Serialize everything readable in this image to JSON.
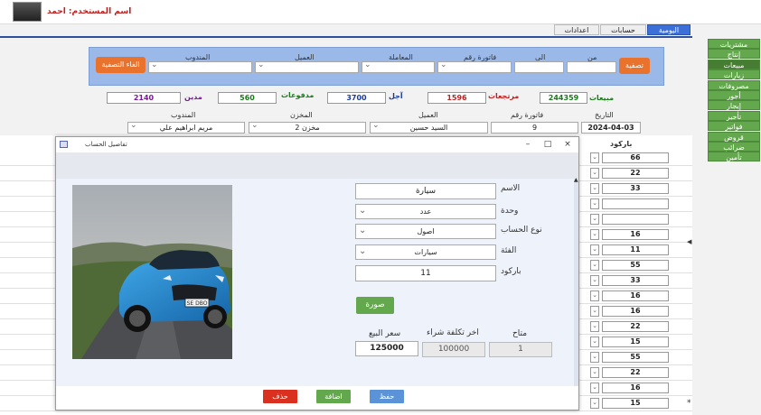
{
  "header": {
    "username_label": "اسم المستخدم: احمد"
  },
  "tabs": [
    "اليومية",
    "حسابات",
    "اعدادات"
  ],
  "filter": {
    "filter_btn": "تصفية",
    "cancel_filter_btn": "الغاء التصفية",
    "from_label": "من",
    "to_label": "الى",
    "invoice_label": "فاتورة رقم",
    "transaction_label": "المعاملة",
    "customer_label": "العميل",
    "rep_label": "المندوب"
  },
  "summary": {
    "sales_label": "مبيعات",
    "sales_value": "244359",
    "returns_label": "مرتجعات",
    "returns_value": "1596",
    "deferred_label": "آجل",
    "deferred_value": "3700",
    "payments_label": "مدفوعات",
    "payments_value": "560",
    "debtor_label": "مدين",
    "debtor_value": "2140"
  },
  "record": {
    "date_label": "التاريخ",
    "date_value": "2024-04-03",
    "invoice_label": "فاتورة رقم",
    "invoice_value": "9",
    "customer_label": "العميل",
    "customer_value": "السيد حسين",
    "warehouse_label": "المخزن",
    "warehouse_value": "مخزن 2",
    "rep_label": "المندوب",
    "rep_value": "مريم ابراهيم علي"
  },
  "grid": {
    "barcode_header": "باركود",
    "barcodes": [
      "66",
      "22",
      "33",
      "",
      "",
      "16",
      "11",
      "55",
      "33",
      "16",
      "16",
      "22",
      "15",
      "55",
      "22",
      "16",
      "15"
    ]
  },
  "right_menu": [
    "مشتريات",
    "إنتاج",
    "مبيعات",
    "زيارات",
    "مصروفات",
    "أجور",
    "إيجار",
    "تأجير",
    "فواتير",
    "قروض",
    "ضرائب",
    "تأمين"
  ],
  "dialog": {
    "title": "تفاصيل الحساب",
    "name_label": "الاسم",
    "name_value": "سيارة",
    "unit_label": "وحدة",
    "unit_value": "عدد",
    "account_type_label": "نوع الحساب",
    "account_type_value": "اصول",
    "category_label": "الفئة",
    "category_value": "سيارات",
    "barcode_label": "باركود",
    "barcode_value": "11",
    "image_btn": "صورة",
    "available_label": "متاح",
    "available_value": "1",
    "last_cost_label": "اخر تكلفة شراء",
    "last_cost_value": "100000",
    "sale_price_label": "سعر البيع",
    "sale_price_value": "125000",
    "delete_btn": "حذف",
    "add_btn": "اضافة",
    "save_btn": "حفظ",
    "plate_text": "SE DBO"
  },
  "colors": {
    "sales": "#1a7a1a",
    "returns": "#c02020",
    "deferred": "#1a3aa0",
    "payments": "#1a7a1a",
    "debtor": "#7a1a9a"
  }
}
